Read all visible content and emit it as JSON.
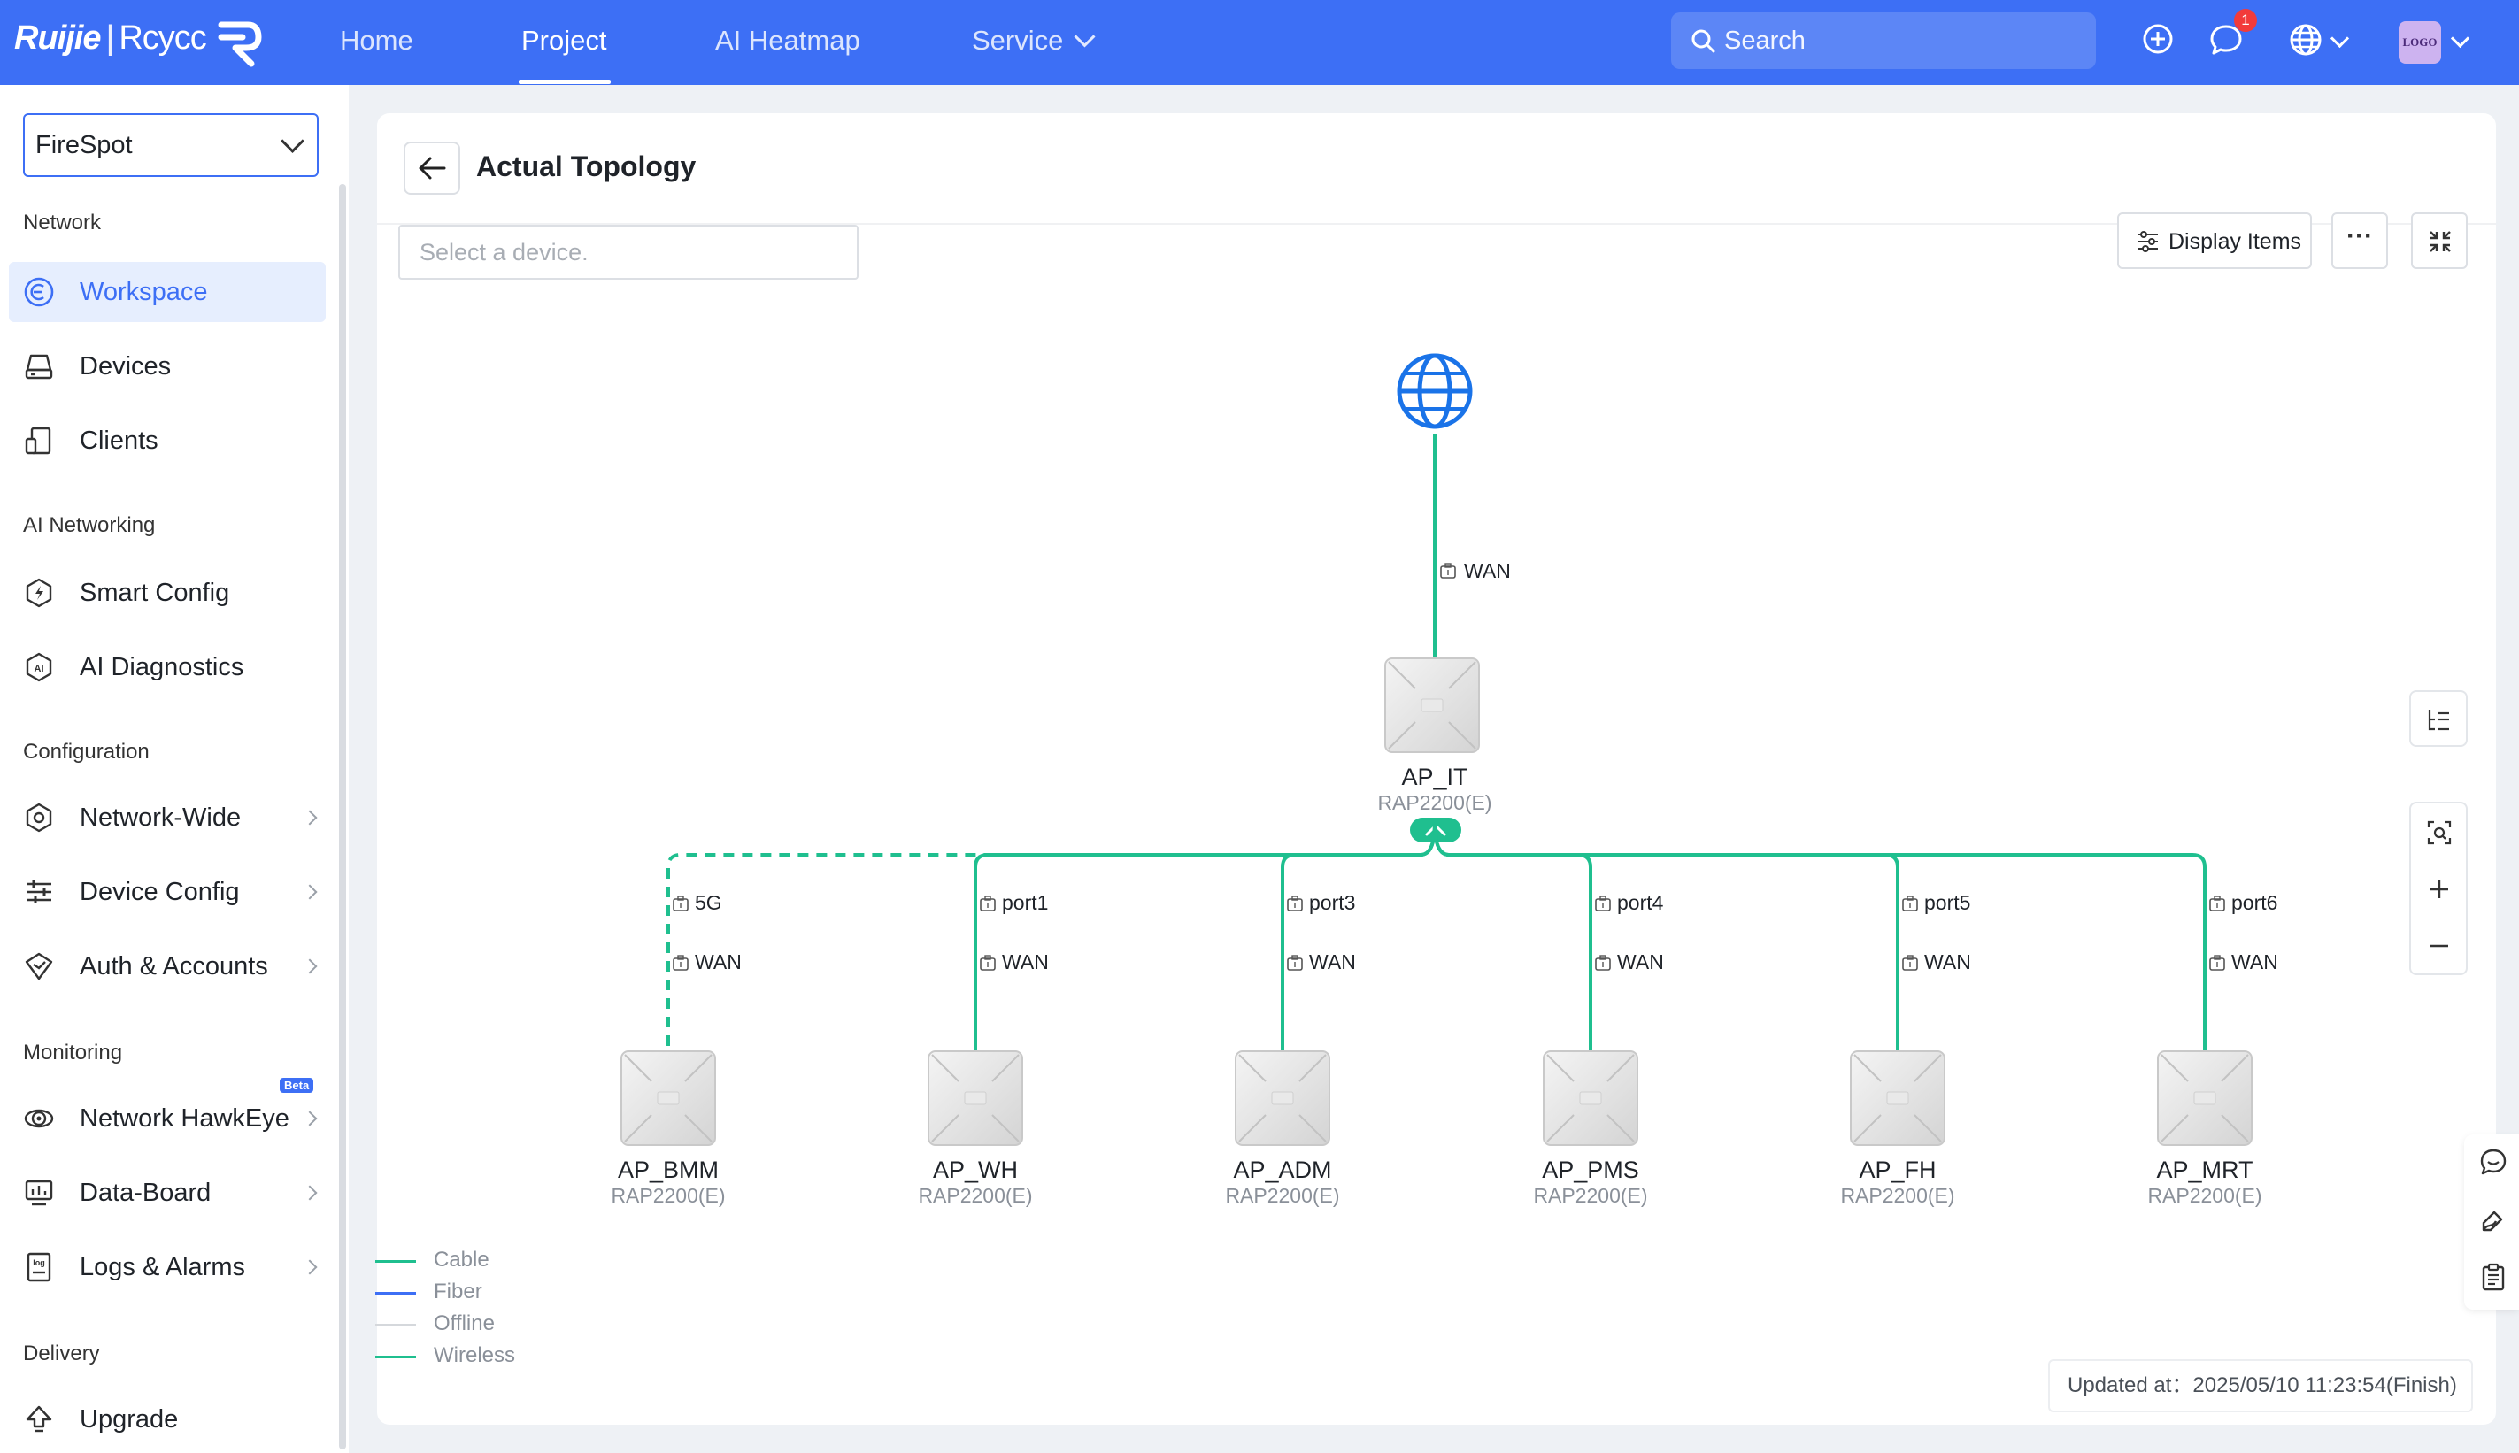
{
  "brand": {
    "name": "Ruijie",
    "separator": "|",
    "sub": "Rcycc"
  },
  "nav": {
    "items": [
      {
        "label": "Home"
      },
      {
        "label": "Project"
      },
      {
        "label": "AI Heatmap"
      },
      {
        "label": "Service"
      }
    ],
    "active": "Project"
  },
  "search": {
    "placeholder": "Search"
  },
  "header": {
    "notification_count": "1",
    "avatar_text": "LOGO"
  },
  "sidebar": {
    "project": "FireSpot",
    "sections": {
      "network": "Network",
      "ai_networking": "AI Networking",
      "configuration": "Configuration",
      "monitoring": "Monitoring",
      "delivery": "Delivery"
    },
    "items": {
      "workspace": "Workspace",
      "devices": "Devices",
      "clients": "Clients",
      "smart_config": "Smart Config",
      "ai_diagnostics": "AI Diagnostics",
      "network_wide": "Network-Wide",
      "device_config": "Device Config",
      "auth_accounts": "Auth & Accounts",
      "network_hawkeye": "Network HawkEye",
      "data_board": "Data-Board",
      "logs_alarms": "Logs & Alarms",
      "upgrade": "Upgrade"
    },
    "beta_label": "Beta"
  },
  "page": {
    "title": "Actual Topology",
    "device_select_placeholder": "Select a device.",
    "display_items_label": "Display Items",
    "more_label": "···"
  },
  "topology": {
    "root_link_label": "WAN",
    "root_device": {
      "name": "AP_IT",
      "model": "RAP2200(E)"
    },
    "children": [
      {
        "name": "AP_BMM",
        "model": "RAP2200(E)",
        "uplink": "5G",
        "port": "WAN",
        "link": "wireless"
      },
      {
        "name": "AP_WH",
        "model": "RAP2200(E)",
        "uplink": "port1",
        "port": "WAN",
        "link": "cable"
      },
      {
        "name": "AP_ADM",
        "model": "RAP2200(E)",
        "uplink": "port3",
        "port": "WAN",
        "link": "cable"
      },
      {
        "name": "AP_PMS",
        "model": "RAP2200(E)",
        "uplink": "port4",
        "port": "WAN",
        "link": "cable"
      },
      {
        "name": "AP_FH",
        "model": "RAP2200(E)",
        "uplink": "port5",
        "port": "WAN",
        "link": "cable"
      },
      {
        "name": "AP_MRT",
        "model": "RAP2200(E)",
        "uplink": "port6",
        "port": "WAN",
        "link": "cable"
      }
    ]
  },
  "legend": [
    {
      "label": "Cable",
      "color": "#1fbf8f"
    },
    {
      "label": "Fiber",
      "color": "#3d6ff5"
    },
    {
      "label": "Offline",
      "color": "#d5d8dc"
    },
    {
      "label": "Wireless",
      "color": "#1fbf8f"
    }
  ],
  "updated": {
    "label": "Updated at：",
    "value": "2025/05/10 11:23:54(Finish)"
  },
  "colors": {
    "primary": "#3d6ff5",
    "link": "#1fbf8f",
    "internet": "#1a73e8"
  }
}
